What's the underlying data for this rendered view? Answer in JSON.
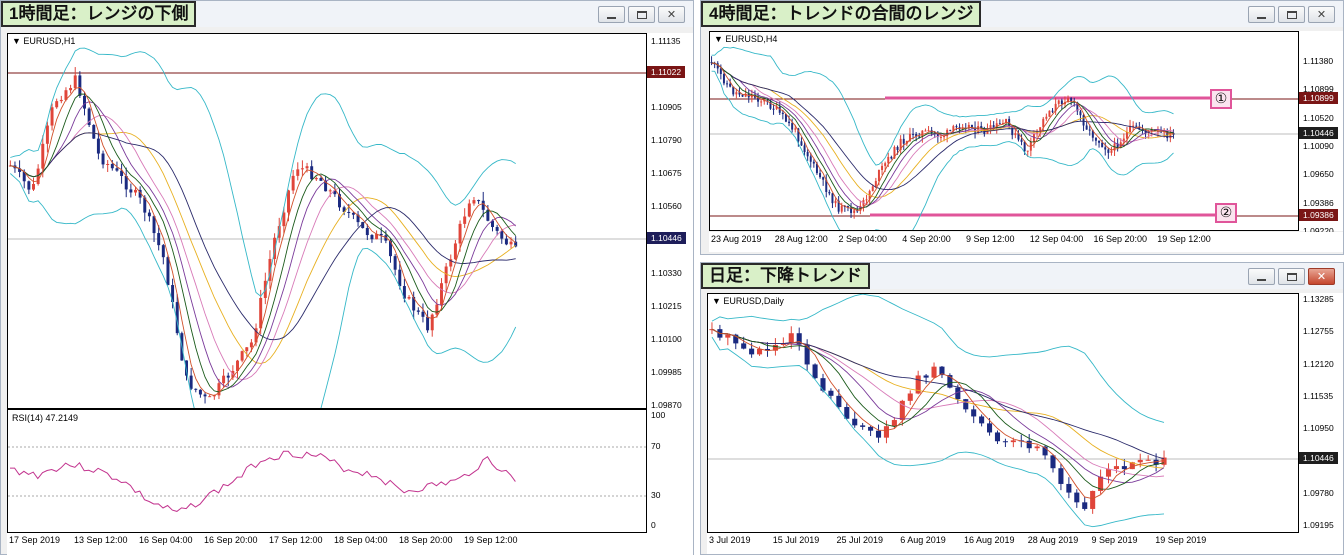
{
  "colors": {
    "bull": "#e0453a",
    "bear": "#1b2a80",
    "res_line": "#7a1515",
    "bb": "#36b8c8",
    "pink_line": "#e0559a",
    "rsi": "#c2338e",
    "ma1": "#e8b020",
    "ma2": "#d87ab8",
    "ma3": "#7a3a9a",
    "ma4": "#2b2b6b",
    "ma5": "#1a5a1a",
    "ma6": "#d0502a"
  },
  "windows": [
    {
      "title": "1時間足：レンジの下側",
      "symbol": "EURUSD,H1",
      "yticks": [
        "1.11135",
        "1.11020",
        "1.10905",
        "1.10790",
        "1.10675",
        "1.10560",
        "1.10445",
        "1.10330",
        "1.10215",
        "1.10100",
        "1.09985",
        "1.09870"
      ],
      "price_tags": [
        "1.11022",
        "1.10446"
      ],
      "rsi": {
        "label": "RSI(14) 47.2149",
        "ticks": [
          "100",
          "70",
          "30",
          "0"
        ]
      },
      "xticks": [
        "17 Sep 2019",
        "13 Sep 12:00",
        "16 Sep 04:00",
        "16 Sep 20:00",
        "17 Sep 12:00",
        "18 Sep 04:00",
        "18 Sep 20:00",
        "19 Sep 12:00"
      ],
      "controls": [
        "minimize-icon",
        "maximize-icon",
        "close-icon"
      ]
    },
    {
      "title": "4時間足：トレンドの合間のレンジ",
      "symbol": "EURUSD,H4",
      "yticks": [
        "1.11380",
        "1.10899",
        "1.10520",
        "1.10090",
        "1.09650",
        "1.09386",
        "1.09220"
      ],
      "price_tags": [
        "1.10899",
        "1.10446",
        "1.09386"
      ],
      "markers": [
        "①",
        "②"
      ],
      "xticks": [
        "23 Aug 2019",
        "28 Aug 12:00",
        "2 Sep 04:00",
        "4 Sep 20:00",
        "9 Sep 12:00",
        "12 Sep 04:00",
        "16 Sep 20:00",
        "19 Sep 12:00"
      ],
      "controls": [
        "minimize-icon",
        "maximize-icon",
        "close-icon"
      ]
    },
    {
      "title": "日足：下降トレンド",
      "symbol": "EURUSD,Daily",
      "yticks": [
        "1.13285",
        "1.12755",
        "1.12120",
        "1.11535",
        "1.10950",
        "1.10446",
        "1.09780",
        "1.09195"
      ],
      "price_tags": [
        "1.10446"
      ],
      "xticks": [
        "3 Jul 2019",
        "15 Jul 2019",
        "25 Jul 2019",
        "6 Aug 2019",
        "16 Aug 2019",
        "28 Aug 2019",
        "9 Sep 2019",
        "19 Sep 2019"
      ],
      "controls": [
        "minimize-icon",
        "maximize-icon",
        "close-icon"
      ]
    }
  ]
}
